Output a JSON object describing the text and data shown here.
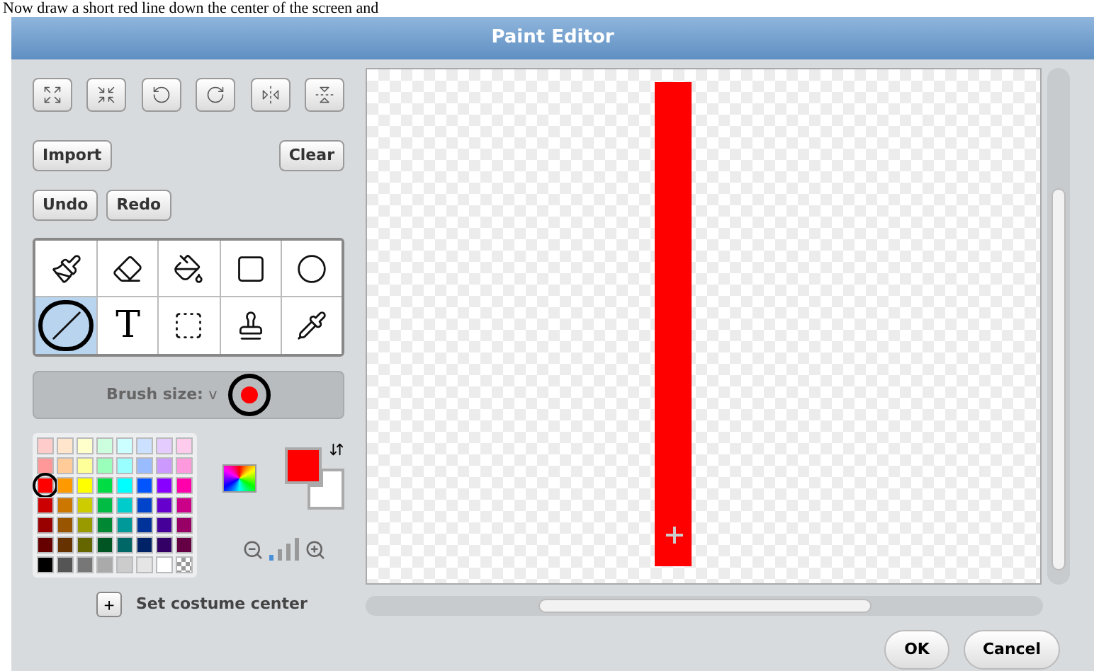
{
  "caption": "Now draw a short red line down the center of the screen and",
  "window": {
    "title": "Paint Editor"
  },
  "transform_buttons": [
    {
      "kind": "grow"
    },
    {
      "kind": "shrink"
    },
    {
      "kind": "rotate-left"
    },
    {
      "kind": "rotate-right"
    },
    {
      "kind": "flip-h"
    },
    {
      "kind": "flip-v"
    }
  ],
  "import_button": "Import",
  "clear_button": "Clear",
  "undo_button": "Undo",
  "redo_button": "Redo",
  "tools": [
    {
      "kind": "brush",
      "selected": false
    },
    {
      "kind": "eraser",
      "selected": false
    },
    {
      "kind": "fill",
      "selected": false
    },
    {
      "kind": "rectangle",
      "selected": false
    },
    {
      "kind": "ellipse",
      "selected": false
    },
    {
      "kind": "line",
      "selected": true
    },
    {
      "kind": "text",
      "selected": false
    },
    {
      "kind": "select",
      "selected": false
    },
    {
      "kind": "stamp",
      "selected": false
    },
    {
      "kind": "eyedropper",
      "selected": false
    }
  ],
  "text_glyph": "T",
  "brush": {
    "label": "Brush size:",
    "caret": "v",
    "color": "#ff0000"
  },
  "palette": [
    {
      "kind": "color",
      "color": "#ffcccc",
      "selected": false
    },
    {
      "kind": "color",
      "color": "#ffe5cc",
      "selected": false
    },
    {
      "kind": "color",
      "color": "#ffffcc",
      "selected": false
    },
    {
      "kind": "color",
      "color": "#ccffdd",
      "selected": false
    },
    {
      "kind": "color",
      "color": "#ccffff",
      "selected": false
    },
    {
      "kind": "color",
      "color": "#cce0ff",
      "selected": false
    },
    {
      "kind": "color",
      "color": "#e5ccff",
      "selected": false
    },
    {
      "kind": "color",
      "color": "#ffccee",
      "selected": false
    },
    {
      "kind": "color",
      "color": "#ff9999",
      "selected": false
    },
    {
      "kind": "color",
      "color": "#ffcc99",
      "selected": false
    },
    {
      "kind": "color",
      "color": "#ffff99",
      "selected": false
    },
    {
      "kind": "color",
      "color": "#99ffbb",
      "selected": false
    },
    {
      "kind": "color",
      "color": "#99ffff",
      "selected": false
    },
    {
      "kind": "color",
      "color": "#99bbff",
      "selected": false
    },
    {
      "kind": "color",
      "color": "#cc99ff",
      "selected": false
    },
    {
      "kind": "color",
      "color": "#ff99dd",
      "selected": false
    },
    {
      "kind": "color",
      "color": "#ff0000",
      "selected": true
    },
    {
      "kind": "color",
      "color": "#ff9900",
      "selected": false
    },
    {
      "kind": "color",
      "color": "#ffff00",
      "selected": false
    },
    {
      "kind": "color",
      "color": "#00dd44",
      "selected": false
    },
    {
      "kind": "color",
      "color": "#00ffff",
      "selected": false
    },
    {
      "kind": "color",
      "color": "#0055ff",
      "selected": false
    },
    {
      "kind": "color",
      "color": "#8800ff",
      "selected": false
    },
    {
      "kind": "color",
      "color": "#ff00aa",
      "selected": false
    },
    {
      "kind": "color",
      "color": "#cc0000",
      "selected": false
    },
    {
      "kind": "color",
      "color": "#cc7700",
      "selected": false
    },
    {
      "kind": "color",
      "color": "#cccc00",
      "selected": false
    },
    {
      "kind": "color",
      "color": "#00bb44",
      "selected": false
    },
    {
      "kind": "color",
      "color": "#00cccc",
      "selected": false
    },
    {
      "kind": "color",
      "color": "#0044cc",
      "selected": false
    },
    {
      "kind": "color",
      "color": "#6600cc",
      "selected": false
    },
    {
      "kind": "color",
      "color": "#cc0088",
      "selected": false
    },
    {
      "kind": "color",
      "color": "#990000",
      "selected": false
    },
    {
      "kind": "color",
      "color": "#995500",
      "selected": false
    },
    {
      "kind": "color",
      "color": "#999900",
      "selected": false
    },
    {
      "kind": "color",
      "color": "#008833",
      "selected": false
    },
    {
      "kind": "color",
      "color": "#009999",
      "selected": false
    },
    {
      "kind": "color",
      "color": "#003399",
      "selected": false
    },
    {
      "kind": "color",
      "color": "#440099",
      "selected": false
    },
    {
      "kind": "color",
      "color": "#990066",
      "selected": false
    },
    {
      "kind": "color",
      "color": "#660000",
      "selected": false
    },
    {
      "kind": "color",
      "color": "#663300",
      "selected": false
    },
    {
      "kind": "color",
      "color": "#666600",
      "selected": false
    },
    {
      "kind": "color",
      "color": "#005522",
      "selected": false
    },
    {
      "kind": "color",
      "color": "#006666",
      "selected": false
    },
    {
      "kind": "color",
      "color": "#002266",
      "selected": false
    },
    {
      "kind": "color",
      "color": "#330066",
      "selected": false
    },
    {
      "kind": "color",
      "color": "#660044",
      "selected": false
    },
    {
      "kind": "color",
      "color": "#000000",
      "selected": false
    },
    {
      "kind": "color",
      "color": "#555555",
      "selected": false
    },
    {
      "kind": "color",
      "color": "#777777",
      "selected": false
    },
    {
      "kind": "color",
      "color": "#aaaaaa",
      "selected": false
    },
    {
      "kind": "color",
      "color": "#cccccc",
      "selected": false
    },
    {
      "kind": "color",
      "color": "#e5e5e5",
      "selected": false
    },
    {
      "kind": "color",
      "color": "#ffffff",
      "selected": false
    },
    {
      "kind": "transparent",
      "selected": false
    }
  ],
  "foreground": {
    "color": "#ff0000"
  },
  "background": {
    "color": "#ffffff"
  },
  "set_center": {
    "icon": "+",
    "label": "Set costume center"
  },
  "ok_button": "OK",
  "cancel_button": "Cancel"
}
